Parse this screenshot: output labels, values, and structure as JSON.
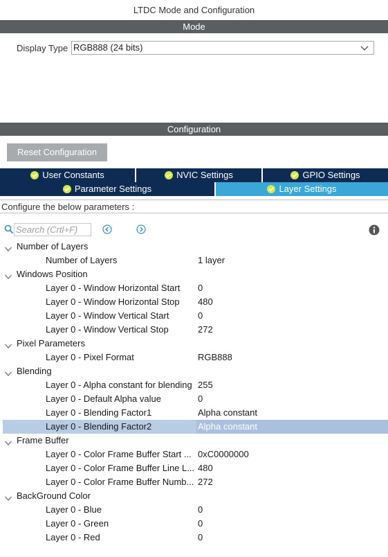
{
  "window": {
    "title": "LTDC Mode and Configuration"
  },
  "mode": {
    "header": "Mode",
    "display_type_label": "Display Type",
    "display_type_value": "RGB888 (24 bits)"
  },
  "configuration": {
    "header": "Configuration",
    "reset_label": "Reset Configuration",
    "tabs_row1": [
      {
        "label": "User Constants",
        "icon": "check-circle-icon"
      },
      {
        "label": "NVIC Settings",
        "icon": "check-circle-icon"
      },
      {
        "label": "GPIO Settings",
        "icon": "check-circle-icon"
      }
    ],
    "tabs_row2": [
      {
        "label": "Parameter Settings",
        "icon": "check-circle-icon"
      },
      {
        "label": "Layer Settings",
        "icon": "check-circle-icon",
        "active": true
      }
    ],
    "configure_text": "Configure the below parameters :",
    "search_placeholder": "Search (Crtl+F)"
  },
  "groups": [
    {
      "name": "Number of Layers",
      "params": [
        {
          "name": "Number of Layers",
          "value": "1 layer"
        }
      ]
    },
    {
      "name": "Windows Position",
      "params": [
        {
          "name": "Layer 0 - Window Horizontal Start",
          "value": "0"
        },
        {
          "name": "Layer 0 - Window Horizontal Stop",
          "value": "480"
        },
        {
          "name": "Layer 0 - Window Vertical Start",
          "value": "0"
        },
        {
          "name": "Layer 0 - Window Vertical Stop",
          "value": "272"
        }
      ]
    },
    {
      "name": "Pixel Parameters",
      "params": [
        {
          "name": "Layer 0 - Pixel Format",
          "value": "RGB888"
        }
      ]
    },
    {
      "name": "Blending",
      "params": [
        {
          "name": "Layer 0 - Alpha constant for blending",
          "value": "255"
        },
        {
          "name": "Layer 0 - Default Alpha value",
          "value": "0"
        },
        {
          "name": "Layer 0 - Blending Factor1",
          "value": "Alpha constant"
        },
        {
          "name": "Layer 0 - Blending Factor2",
          "value": "Alpha constant",
          "selected": true
        }
      ]
    },
    {
      "name": "Frame Buffer",
      "params": [
        {
          "name": "Layer 0 - Color Frame Buffer Start ...",
          "value": "0xC0000000"
        },
        {
          "name": "Layer 0 - Color Frame Buffer Line L...",
          "value": "480"
        },
        {
          "name": "Layer 0 - Color Frame Buffer Numb...",
          "value": "272"
        }
      ]
    },
    {
      "name": "BackGround Color",
      "params": [
        {
          "name": "Layer 0 - Blue",
          "value": "0"
        },
        {
          "name": "Layer 0 - Green",
          "value": "0"
        },
        {
          "name": "Layer 0 - Red",
          "value": "0"
        }
      ]
    }
  ],
  "colors": {
    "section_bar": "#5b5e60",
    "tab_dark": "#0e2c53",
    "tab_active": "#39a8d8",
    "check": "#d4e84a",
    "selection": "#b8cde4"
  }
}
